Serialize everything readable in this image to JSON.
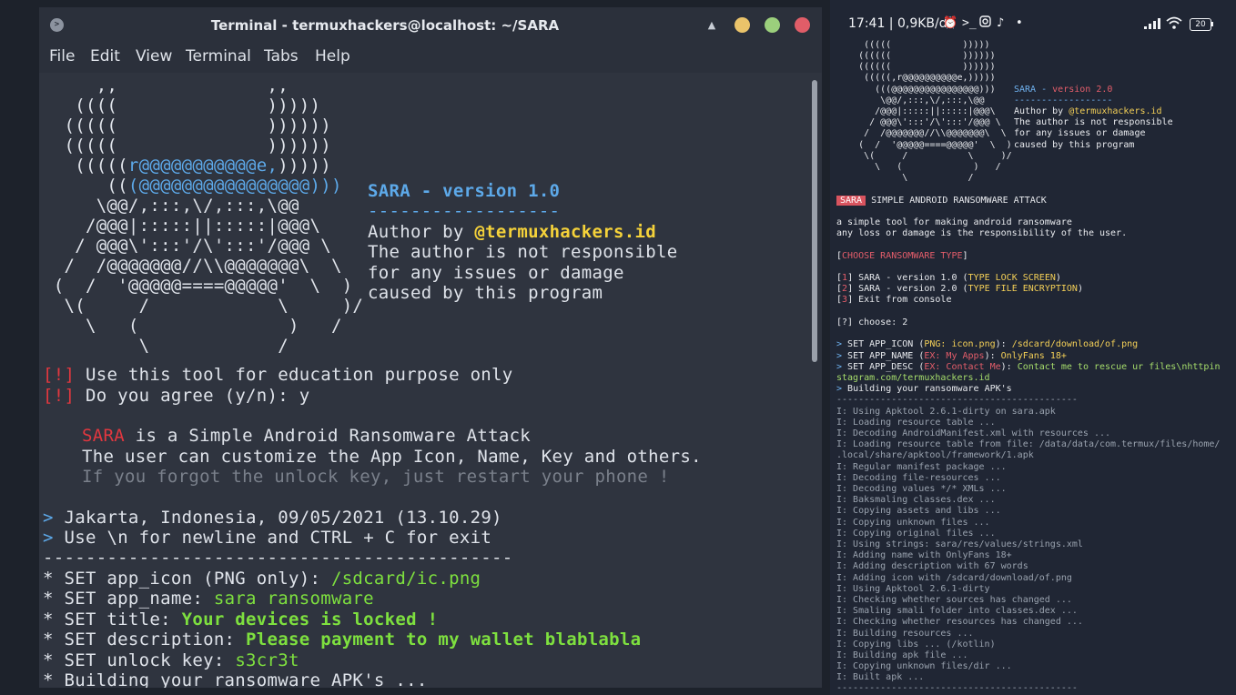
{
  "terminal": {
    "title": "Terminal - termuxhackers@localhost: ~/SARA",
    "app_icon_glyph": ">",
    "roll_glyph": "▲",
    "menu": [
      "File",
      "Edit",
      "View",
      "Terminal",
      "Tabs",
      "Help"
    ],
    "banner": {
      "art": [
        "     ,,              ,,",
        "   ((((              )))))",
        "  (((((              ))))))",
        "  (((((              ))))))",
        "   (((((",
        "      ((",
        "     \\@@/,:::,\\/,:::,\\@@",
        "    /@@@|:::::||:::::|@@@\\",
        "   / @@@\\':::'/\\':::'/@@@ \\",
        "  /  /@@@@@@@//\\\\@@@@@@@\\  \\",
        " (  /  '@@@@@====@@@@@'  \\  )",
        "  \\(     /            \\     )/",
        "    \\   (              )   /",
        "         \\            /"
      ],
      "art_row5_blue": "r@@@@@@@@@@@e,",
      "art_row5_tail": ")))))",
      "art_row6_blue": "(@@@@@@@@@@@@@@@@)))",
      "version_title": "SARA - version 1.0",
      "divider": "------------------",
      "author_prefix": "Author by ",
      "author_handle": "@termuxhackers.id",
      "disclaimer": [
        "The author is not responsible",
        "for any issues or damage",
        "caused by this program"
      ]
    },
    "warning_tag": "[!]",
    "warnings": [
      "Use this tool for education purpose only",
      "Do you agree (y/n): y"
    ],
    "intro": {
      "name": "SARA",
      "line1_rest": " is a Simple Android Ransomware Attack",
      "line2": "The user can customize the App Icon, Name, Key and others.",
      "line3": "If you forgot the unlock key, just restart your phone !"
    },
    "prompt_glyph": ">",
    "info": [
      "Jakarta, Indonesia, 09/05/2021 (13.10.29)",
      "Use \\n for newline and CTRL + C for exit"
    ],
    "separator": "--------------------------------------------",
    "settings": [
      {
        "label": "* SET app_icon (PNG only): ",
        "value": "/sdcard/ic.png"
      },
      {
        "label": "* SET app_name: ",
        "value": "sara ransomware"
      },
      {
        "label": "* SET title: ",
        "value": "Your devices is locked !"
      },
      {
        "label": "* SET description: ",
        "value": "Please payment to my wallet blablabla"
      },
      {
        "label": "* SET unlock key: ",
        "value": "s3cr3t"
      }
    ],
    "building": "* Building your ransomware APK's ..."
  },
  "phone": {
    "status": {
      "time": "17:41 | 0,9KB/d",
      "icons": [
        "alarm-icon",
        "terminal-icon",
        "instagram-icon",
        "tiktok-icon",
        "dot-icon"
      ],
      "battery": "20"
    },
    "banner": {
      "art": [
        "     (((((             )))))",
        "    ((((((             ))))))",
        "    ((((((             ))))))",
        "     (((((,r@@@@@@@@@@e,)))))",
        "       (((@@@@@@@@@@@@@@@@)))",
        "        \\@@/,:::,\\/,:::,\\@@",
        "       /@@@|:::::||:::::|@@@\\",
        "      / @@@\\':::'/\\':::'/@@@ \\",
        "     /  /@@@@@@@//\\\\@@@@@@@\\  \\",
        "    (  /  '@@@@@====@@@@@'  \\  )",
        "     \\(     /           \\     )/",
        "       \\   (             )   /",
        "            \\           /"
      ],
      "version_title": "SARA - version 2.0",
      "version_name": "SARA - ",
      "version_num": "version 2.0",
      "divider": "------------------",
      "author_prefix": "Author by ",
      "author_handle": "@termuxhackers.id",
      "disclaimer": [
        "The author is not responsible",
        "for any issues or damage",
        "caused by this program"
      ]
    },
    "badge": "SARA",
    "badge_text": " SIMPLE ANDROID RANSOMWARE ATTACK",
    "description": [
      "a simple tool for making android ransomware",
      "any loss or damage is the responsibility of the user."
    ],
    "choose_header": "CHOOSE RANSOMWARE TYPE",
    "options": [
      {
        "num": "1",
        "label": " SARA - version 1.0 (",
        "type": "TYPE LOCK SCREEN",
        "close": ")"
      },
      {
        "num": "2",
        "label": " SARA - version 2.0 (",
        "type": "TYPE FILE ENCRYPTION",
        "close": ")"
      },
      {
        "num": "3",
        "label": " Exit from console",
        "type": "",
        "close": ""
      }
    ],
    "choose_prompt": "[?] choose: 2",
    "sets": [
      {
        "key": " SET APP_ICON (",
        "hint": "PNG: icon.png",
        "close": "): ",
        "value": "/sdcard/download/of.png"
      },
      {
        "key": " SET APP_NAME (",
        "hint": "EX: My Apps",
        "close": "): ",
        "value": "OnlyFans 18+"
      },
      {
        "key": " SET APP_DESC (",
        "hint": "EX: Contact Me",
        "close": "): ",
        "value": "Contact me to rescue ur files\\nhttpin"
      }
    ],
    "desc_wrap": "stagram.com/termuxhackers.id",
    "building": " Building your ransomware APK's",
    "separator": "--------------------------------------------",
    "log": [
      "I: Using Apktool 2.6.1-dirty on sara.apk",
      "I: Loading resource table ...",
      "I: Decoding AndroidManifest.xml with resources ...",
      "I: Loading resource table from file: /data/data/com.termux/files/home/",
      ".local/share/apktool/framework/1.apk",
      "I: Regular manifest package ...",
      "I: Decoding file-resources ...",
      "I: Decoding values */* XMLs ...",
      "I: Baksmaling classes.dex ...",
      "I: Copying assets and libs ...",
      "I: Copying unknown files ...",
      "I: Copying original files ...",
      "I: Using strings: sara/res/values/strings.xml",
      "I: Adding name with OnlyFans 18+",
      "I: Adding description with 67 words",
      "I: Adding icon with /sdcard/download/of.png",
      "I: Using Apktool 2.6.1-dirty",
      "I: Checking whether sources has changed ...",
      "I: Smaling smali folder into classes.dex ...",
      "I: Checking whether resources has changed ...",
      "I: Building resources ...",
      "I: Copying libs ... (/kotlin)",
      "I: Building apk file ...",
      "I: Copying unknown files/dir ...",
      "I: Built apk ..."
    ]
  }
}
